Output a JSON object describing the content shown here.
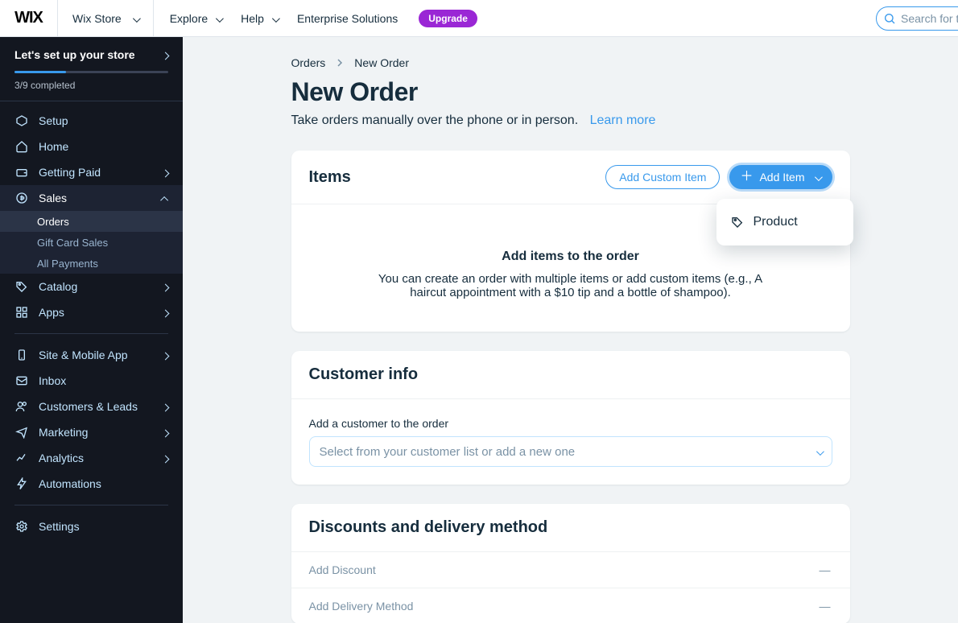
{
  "colors": {
    "accent": "#3899ec",
    "upgrade": "#9a27d5",
    "sidebarBg": "#131720"
  },
  "topbar": {
    "site_label": "Wix Store",
    "menu": [
      {
        "label": "Explore",
        "has_dropdown": true
      },
      {
        "label": "Help",
        "has_dropdown": true
      },
      {
        "label": "Enterprise Solutions",
        "has_dropdown": false
      }
    ],
    "upgrade_label": "Upgrade",
    "search_placeholder": "Search for tools, ap"
  },
  "sidebar": {
    "setup": {
      "title": "Let's set up your store",
      "completed": "3/9 completed",
      "progress_pct": 33.3
    },
    "items": [
      {
        "icon": "setup",
        "label": "Setup",
        "expandable": false
      },
      {
        "icon": "home",
        "label": "Home",
        "expandable": false
      },
      {
        "icon": "wallet",
        "label": "Getting Paid",
        "expandable": true
      },
      {
        "icon": "sales",
        "label": "Sales",
        "expandable": true,
        "open": true,
        "children": [
          {
            "label": "Orders",
            "active": true
          },
          {
            "label": "Gift Card Sales",
            "active": false
          },
          {
            "label": "All Payments",
            "active": false
          }
        ]
      },
      {
        "icon": "catalog",
        "label": "Catalog",
        "expandable": true
      },
      {
        "icon": "apps",
        "label": "Apps",
        "expandable": true
      }
    ],
    "items2": [
      {
        "icon": "mobile",
        "label": "Site & Mobile App",
        "expandable": true
      },
      {
        "icon": "inbox",
        "label": "Inbox",
        "expandable": false
      },
      {
        "icon": "customers",
        "label": "Customers & Leads",
        "expandable": true
      },
      {
        "icon": "marketing",
        "label": "Marketing",
        "expandable": true
      },
      {
        "icon": "analytics",
        "label": "Analytics",
        "expandable": true
      },
      {
        "icon": "automations",
        "label": "Automations",
        "expandable": false
      }
    ],
    "items3": [
      {
        "icon": "settings",
        "label": "Settings",
        "expandable": false
      }
    ]
  },
  "breadcrumb": {
    "root": "Orders",
    "current": "New Order"
  },
  "page": {
    "title": "New Order",
    "subtitle": "Take orders manually over the phone or in person.",
    "learn_more": "Learn more"
  },
  "items_card": {
    "title": "Items",
    "add_custom_label": "Add Custom Item",
    "add_item_label": "Add Item",
    "dropdown": {
      "product": "Product"
    },
    "empty_title": "Add items to the order",
    "empty_desc": "You can create an order with multiple items or add custom items (e.g., A haircut appointment with a $10 tip and a bottle of shampoo)."
  },
  "customer_card": {
    "title": "Customer info",
    "label": "Add a customer to the order",
    "placeholder": "Select from your customer list or add a new one"
  },
  "discounts_card": {
    "title": "Discounts and delivery method",
    "rows": [
      {
        "label": "Add Discount",
        "value": "—"
      },
      {
        "label": "Add Delivery Method",
        "value": "—"
      }
    ]
  }
}
